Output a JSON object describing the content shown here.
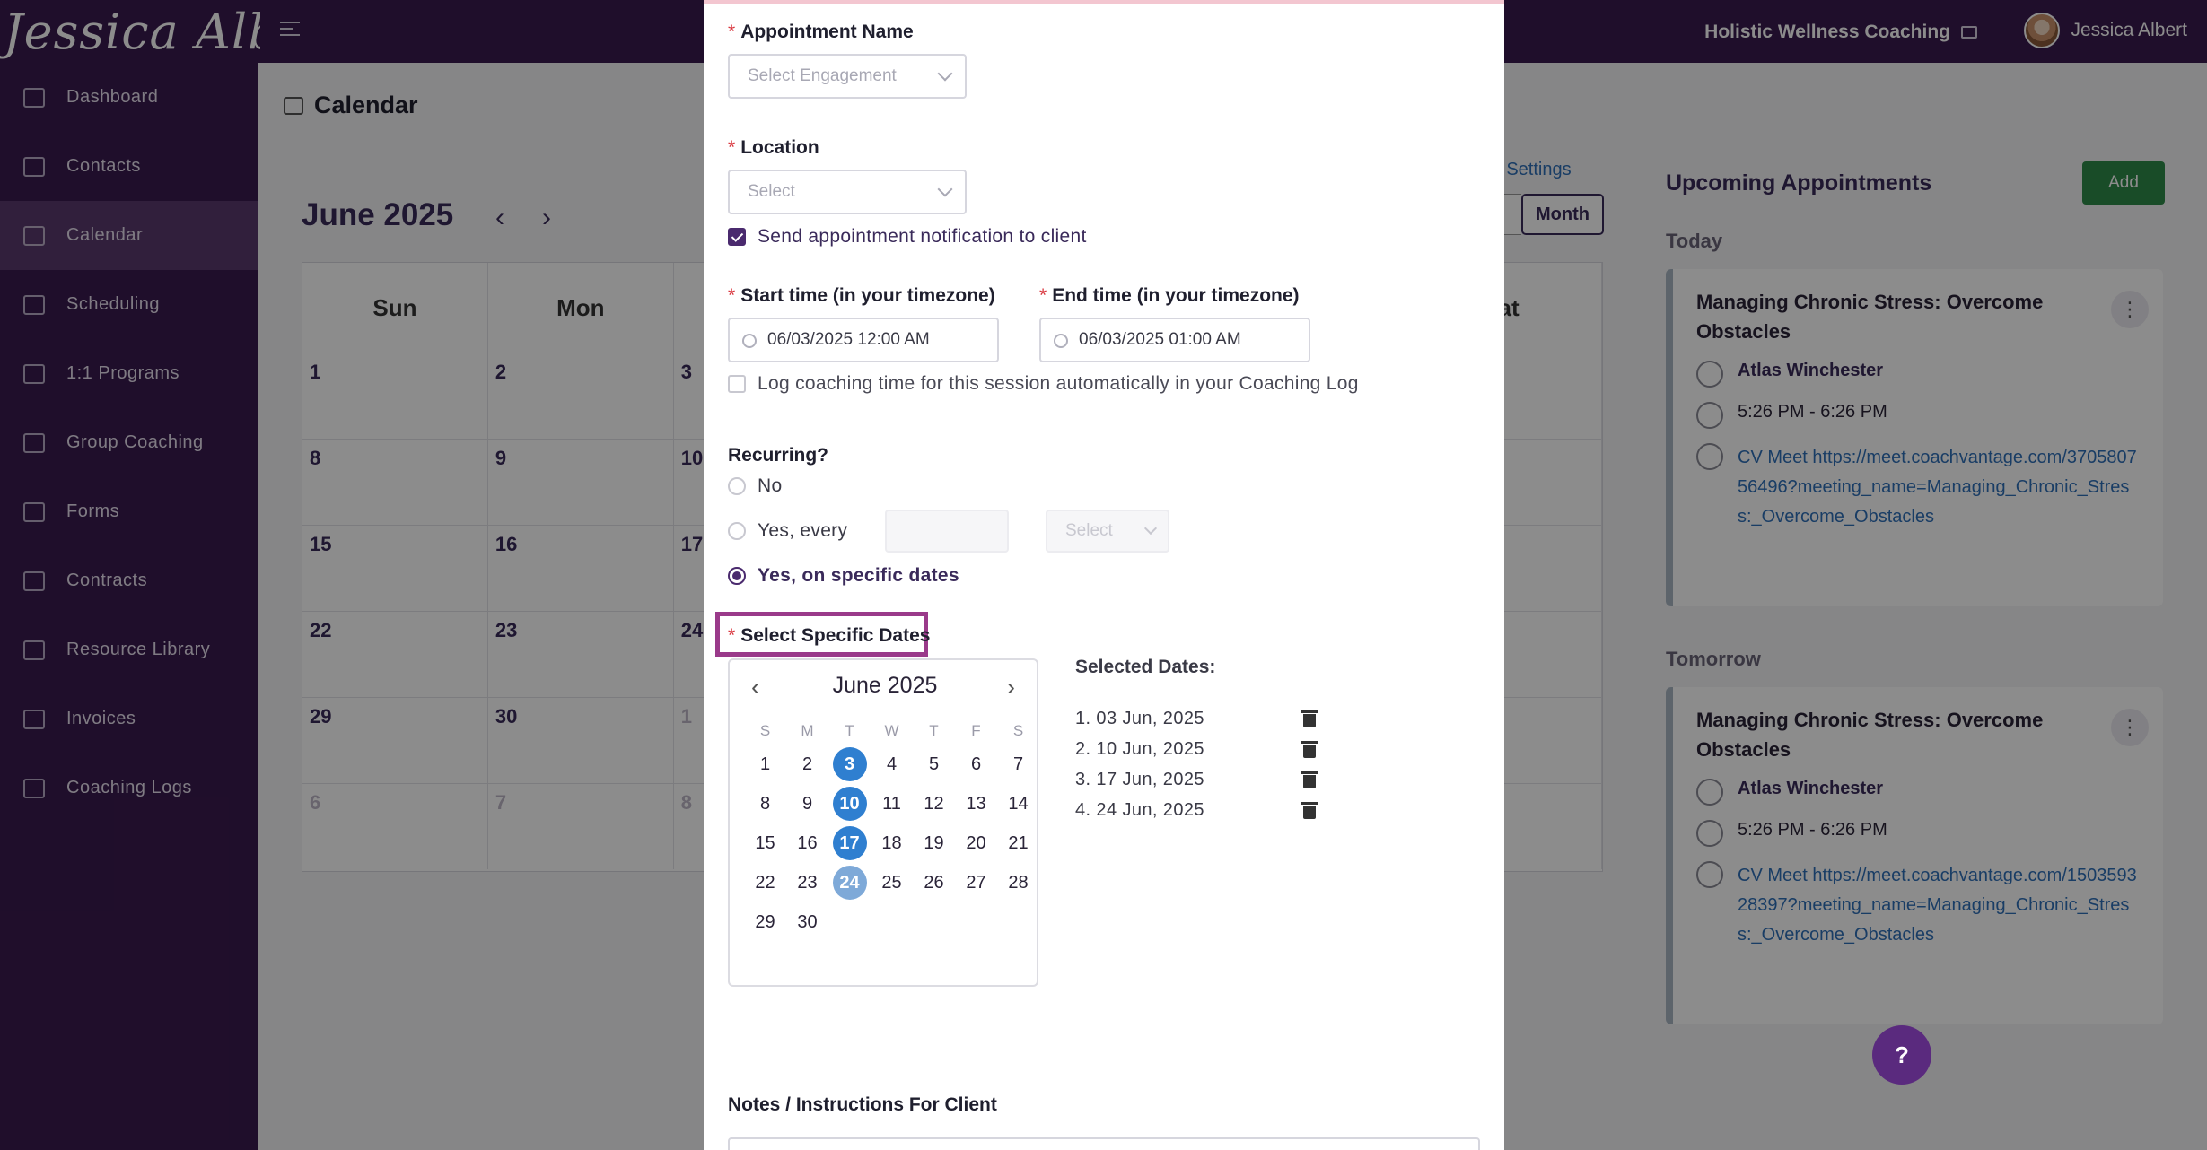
{
  "topbar": {
    "logo_text": "Jessica Albert",
    "org_name": "Holistic Wellness Coaching",
    "user_name": "Jessica Albert"
  },
  "sidebar": {
    "items": [
      {
        "label": "Dashboard",
        "icon": "dashboard-icon"
      },
      {
        "label": "Contacts",
        "icon": "contacts-icon"
      },
      {
        "label": "Calendar",
        "icon": "calendar-icon",
        "active": true
      },
      {
        "label": "Scheduling",
        "icon": "scheduling-icon"
      },
      {
        "label": "1:1 Programs",
        "icon": "book-icon"
      },
      {
        "label": "Group Coaching",
        "icon": "group-icon"
      },
      {
        "label": "Forms",
        "icon": "forms-icon"
      },
      {
        "label": "Contracts",
        "icon": "contract-icon"
      },
      {
        "label": "Resource Library",
        "icon": "library-icon"
      },
      {
        "label": "Invoices",
        "icon": "invoice-icon"
      },
      {
        "label": "Coaching Logs",
        "icon": "clock-icon"
      }
    ]
  },
  "calendar": {
    "page_title": "Calendar",
    "month_title": "June 2025",
    "settings_link": "ar Settings",
    "month_button": "Month",
    "weekdays": [
      "Sun",
      "Mon",
      "",
      "",
      "",
      "",
      "at"
    ],
    "rows": [
      [
        "1",
        "2",
        "3",
        "",
        "",
        "",
        ""
      ],
      [
        "8",
        "9",
        "10",
        "",
        "",
        "",
        ""
      ],
      [
        "15",
        "16",
        "17",
        "",
        "",
        "",
        ""
      ],
      [
        "22",
        "23",
        "24",
        "",
        "",
        "",
        ""
      ],
      [
        "29",
        "30",
        "1",
        "",
        "",
        "",
        ""
      ],
      [
        "6",
        "7",
        "8",
        "",
        "",
        "",
        ""
      ]
    ]
  },
  "upcoming": {
    "title": "Upcoming Appointments",
    "add_label": "Add",
    "today_label": "Today",
    "tomorrow_label": "Tomorrow",
    "appointments": [
      {
        "title": "Managing Chronic Stress: Overcome Obstacles",
        "client": "Atlas Winchester",
        "time": "5:26 PM - 6:26 PM",
        "location": "CV Meet https://meet.coachvantage.com/370580756496?meeting_name=Managing_Chronic_Stress:_Overcome_Obstacles"
      },
      {
        "title": "Managing Chronic Stress: Overcome Obstacles",
        "client": "Atlas Winchester",
        "time": "5:26 PM - 6:26 PM",
        "location": "CV Meet https://meet.coachvantage.com/150359328397?meeting_name=Managing_Chronic_Stress:_Overcome_Obstacles"
      }
    ],
    "help_label": "?"
  },
  "modal": {
    "appointment_name_label": "Appointment Name",
    "engagement_placeholder": "Select Engagement",
    "location_label": "Location",
    "location_placeholder": "Select",
    "notify_label": "Send appointment notification to client",
    "start_label": "Start time (in your timezone)",
    "end_label": "End time (in your timezone)",
    "start_value": "06/03/2025 12:00 AM",
    "end_value": "06/03/2025 01:00 AM",
    "log_label": "Log coaching time for this session automatically in your Coaching Log",
    "recurring_label": "Recurring?",
    "recurring_options": [
      "No",
      "Yes, every",
      "Yes, on specific dates"
    ],
    "recurring_every_select": "Select",
    "specific_dates_label": "Select Specific Dates",
    "picker": {
      "month": "June 2025",
      "weekday_initials": [
        "S",
        "M",
        "T",
        "W",
        "T",
        "F",
        "S"
      ],
      "days": [
        "",
        "",
        "",
        "",
        "",
        "",
        "",
        "1",
        "2",
        "3",
        "4",
        "5",
        "6",
        "7",
        "8",
        "9",
        "10",
        "11",
        "12",
        "13",
        "14",
        "15",
        "16",
        "17",
        "18",
        "19",
        "20",
        "21",
        "22",
        "23",
        "24",
        "25",
        "26",
        "27",
        "28",
        "29",
        "30"
      ],
      "selected": [
        "3",
        "10",
        "17",
        "24"
      ]
    },
    "selected_dates_title": "Selected Dates:",
    "selected_dates": [
      "1. 03 Jun, 2025",
      "2. 10 Jun, 2025",
      "3. 17 Jun, 2025",
      "4. 24 Jun, 2025"
    ],
    "notes_label": "Notes / Instructions For Client"
  }
}
